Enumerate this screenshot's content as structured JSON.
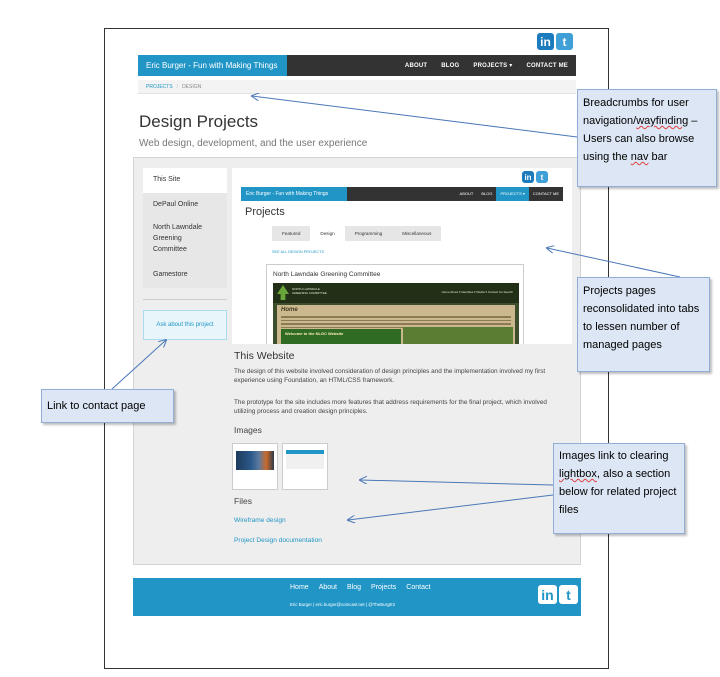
{
  "site": {
    "brand": "Eric Burger - Fun with Making Things",
    "nav": [
      "ABOUT",
      "BLOG",
      "PROJECTS",
      "CONTACT ME"
    ],
    "nav_projects_caret": "▾",
    "social": {
      "linkedin": "in",
      "twitter": "t"
    }
  },
  "breadcrumb": {
    "parent": "PROJECTS",
    "separator": "/",
    "current": "DESIGN"
  },
  "page": {
    "title": "Design Projects",
    "subtitle": "Web design, development, and the user experience"
  },
  "sidebar": {
    "items": [
      "This Site",
      "DePaul Online",
      "North Lawndale Greening Committee",
      "Gamestore"
    ],
    "active_index": 0,
    "ask_link": "Ask about this project"
  },
  "preview": {
    "brand": "Eric Burger - Fun with Making Things",
    "nav": [
      "ABOUT",
      "BLOG",
      "PROJECTS ▾",
      "CONTACT ME"
    ],
    "title": "Projects",
    "tabs": [
      "Featured",
      "Design",
      "Programming",
      "Miscellaneous"
    ],
    "active_tab": 1,
    "see_all": "SEE ALL DESIGN PROJECTS",
    "card_title": "North Lawndale Greening Committee",
    "inner": {
      "org": "NORTH LAWNDALE GREENING COMMITTEE",
      "menu": "Home   About ▾   Identities ▾   Media ▾   Contact Us   Search",
      "home": "Home",
      "welcome": "Welcome to the NLGC Website"
    }
  },
  "project": {
    "title": "This Website",
    "para1": "The design of this website involved consideration of design principles and the implementation involved my first experience using Foundation, an HTML/CSS framework.",
    "para2": "The prototype for the site includes more features that address requirements for the final project, which involved utilizing process and creation design principles.",
    "images_heading": "Images",
    "files_heading": "Files",
    "files": [
      "Wireframe design",
      "Project Design documentation"
    ]
  },
  "footer": {
    "nav": [
      "Home",
      "About",
      "Blog",
      "Projects",
      "Contact"
    ],
    "copy": "Eric Burger  |  eric.burger@comcast.net  |  @TheBurgE3"
  },
  "annotations": {
    "breadcrumbs": {
      "pre": "Breadcrumbs for user navigation/",
      "wayfinding": "wayfinding",
      "mid": " – Users can also browse using the ",
      "nav": "nav",
      "post": " bar"
    },
    "projects_tabs": "Projects pages reconsolidated into tabs to lessen number of managed pages",
    "contact_link": "Link to contact page",
    "images": {
      "pre": "Images link to clearing ",
      "lightbox": "lightbox",
      "post": ", also a section below for related project files"
    }
  },
  "colors": {
    "accent": "#2196c6",
    "dark_nav": "#333333",
    "callout_fill": "#dce6f4",
    "arrow": "#4a78b8"
  }
}
